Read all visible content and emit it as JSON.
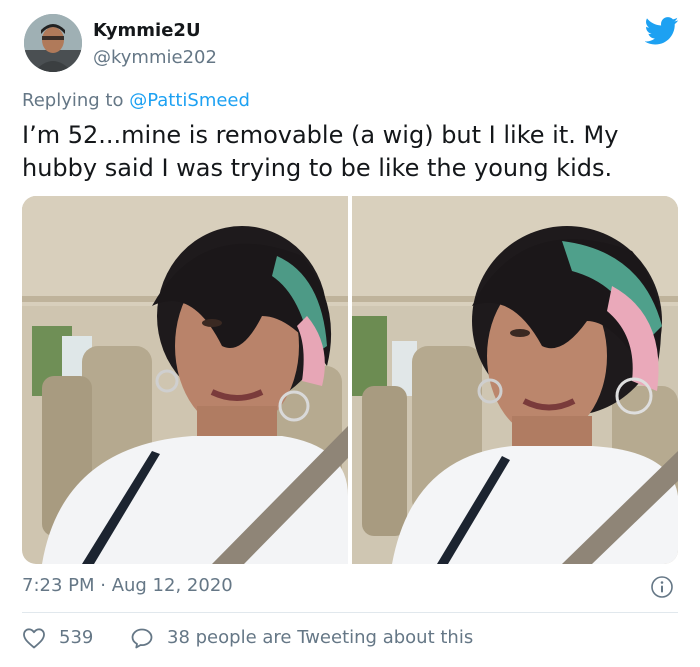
{
  "user": {
    "display_name": "Kymmie2U",
    "handle": "@kymmie202"
  },
  "reply": {
    "prefix": "Replying to ",
    "mention": "@PattiSmeed"
  },
  "tweet": {
    "line1": "I’m 52...mine is removable (a wig) but I like it. My",
    "line2": "hubby said I was trying to be like the young kids."
  },
  "media": {
    "photo_count": 2
  },
  "meta": {
    "timestamp": "7:23 PM · Aug 12, 2020"
  },
  "engagement": {
    "likes": "539",
    "tweeting_about": "38 people are Tweeting about this"
  },
  "icons": {
    "brand": "twitter-bird-icon",
    "info": "info-icon",
    "like": "heart-icon",
    "comment": "speech-bubble-icon"
  },
  "colors": {
    "twitter_blue": "#1da1f2",
    "secondary_text": "#657786",
    "primary_text": "#14171a",
    "divider": "#e1e8ed"
  }
}
